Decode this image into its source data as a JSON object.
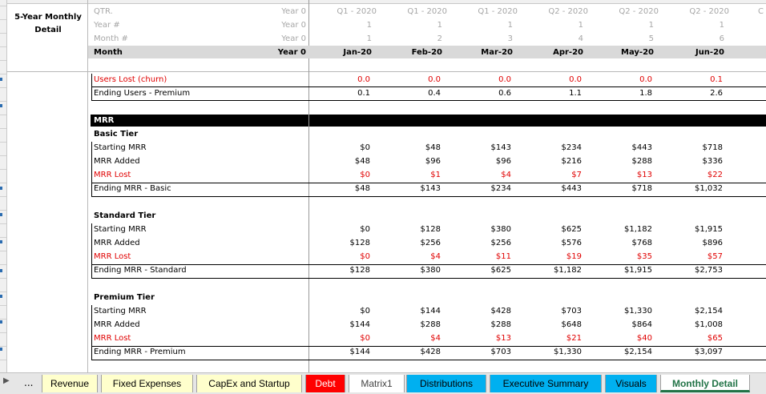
{
  "header": {
    "title_line1": "5-Year Monthly",
    "title_line2": "Detail",
    "labels": [
      "QTR.",
      "Year #",
      "Month #",
      "Month"
    ],
    "year0_values": [
      "Year 0",
      "Year 0",
      "Year 0",
      "Year 0"
    ],
    "qtr": [
      "Q1 - 2020",
      "Q1 - 2020",
      "Q1 - 2020",
      "Q2 - 2020",
      "Q2 - 2020",
      "Q2 - 2020"
    ],
    "year": [
      "1",
      "1",
      "1",
      "1",
      "1",
      "1"
    ],
    "month_num": [
      "1",
      "2",
      "3",
      "4",
      "5",
      "6"
    ],
    "months": [
      "Jan-20",
      "Feb-20",
      "Mar-20",
      "Apr-20",
      "May-20",
      "Jun-20"
    ],
    "overflow_col": "C"
  },
  "users": {
    "lost_label": "Users Lost (churn)",
    "lost": [
      "0.0",
      "0.0",
      "0.0",
      "0.0",
      "0.0",
      "0.1"
    ],
    "ending_label": "Ending Users - Premium",
    "ending": [
      "0.1",
      "0.4",
      "0.6",
      "1.1",
      "1.8",
      "2.6"
    ]
  },
  "mrr": {
    "section_label": "MRR",
    "tiers": [
      {
        "name": "Basic Tier",
        "starting_label": "Starting MRR",
        "starting": [
          "$0",
          "$48",
          "$143",
          "$234",
          "$443",
          "$718"
        ],
        "added_label": "MRR Added",
        "added": [
          "$48",
          "$96",
          "$96",
          "$216",
          "$288",
          "$336"
        ],
        "lost_label": "MRR Lost",
        "lost": [
          "$0",
          "$1",
          "$4",
          "$7",
          "$13",
          "$22"
        ],
        "ending_label": "Ending MRR - Basic",
        "ending": [
          "$48",
          "$143",
          "$234",
          "$443",
          "$718",
          "$1,032"
        ]
      },
      {
        "name": "Standard Tier",
        "starting_label": "Starting MRR",
        "starting": [
          "$0",
          "$128",
          "$380",
          "$625",
          "$1,182",
          "$1,915"
        ],
        "added_label": "MRR Added",
        "added": [
          "$128",
          "$256",
          "$256",
          "$576",
          "$768",
          "$896"
        ],
        "lost_label": "MRR Lost",
        "lost": [
          "$0",
          "$4",
          "$11",
          "$19",
          "$35",
          "$57"
        ],
        "ending_label": "Ending MRR - Standard",
        "ending": [
          "$128",
          "$380",
          "$625",
          "$1,182",
          "$1,915",
          "$2,753"
        ]
      },
      {
        "name": "Premium Tier",
        "starting_label": "Starting MRR",
        "starting": [
          "$0",
          "$144",
          "$428",
          "$703",
          "$1,330",
          "$2,154"
        ],
        "added_label": "MRR Added",
        "added": [
          "$144",
          "$288",
          "$288",
          "$648",
          "$864",
          "$1,008"
        ],
        "lost_label": "MRR Lost",
        "lost": [
          "$0",
          "$4",
          "$13",
          "$21",
          "$40",
          "$65"
        ],
        "ending_label": "Ending MRR - Premium",
        "ending": [
          "$144",
          "$428",
          "$703",
          "$1,330",
          "$2,154",
          "$3,097"
        ]
      }
    ]
  },
  "tabs": {
    "nav_more": "...",
    "items": [
      {
        "label": "Revenue",
        "bg": "#ffffcc",
        "fg": "#000000"
      },
      {
        "label": "Fixed Expenses",
        "bg": "#ffffcc",
        "fg": "#000000"
      },
      {
        "label": "CapEx and Startup",
        "bg": "#ffffcc",
        "fg": "#000000"
      },
      {
        "label": "Debt",
        "bg": "#ff0000",
        "fg": "#ffffff"
      },
      {
        "label": "Matrix1",
        "bg": "#ffffff",
        "fg": "#444444"
      },
      {
        "label": "Distributions",
        "bg": "#00b0f0",
        "fg": "#000000"
      },
      {
        "label": "Executive Summary",
        "bg": "#00b0f0",
        "fg": "#000000"
      },
      {
        "label": "Visuals",
        "bg": "#00b0f0",
        "fg": "#000000"
      },
      {
        "label": "Monthly Detail",
        "bg": "#ffffff",
        "fg": "#217346",
        "active": true
      }
    ]
  }
}
